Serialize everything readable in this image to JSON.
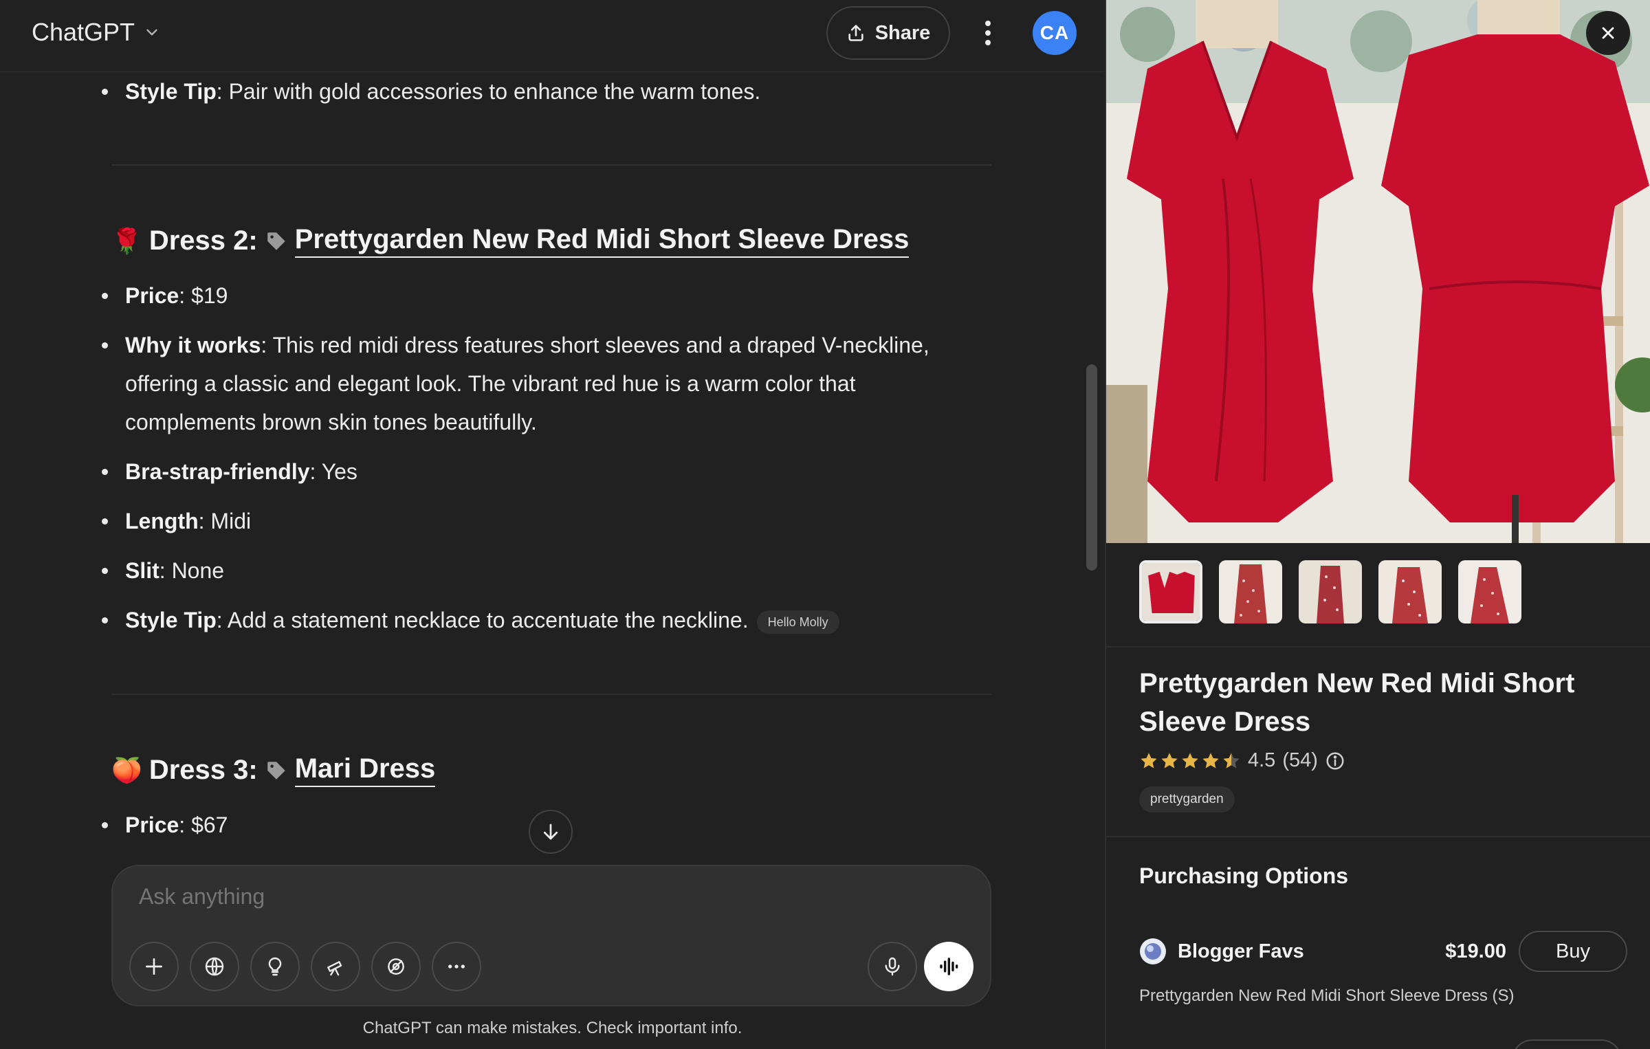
{
  "header": {
    "model_name": "ChatGPT",
    "share_label": "Share",
    "avatar_initials": "CA"
  },
  "chat": {
    "prev_style_tip": {
      "label": "Style Tip",
      "text": ": Pair with gold accessories to enhance the warm tones."
    },
    "dress2": {
      "emoji": "🌹",
      "prefix": "Dress 2:",
      "link_text": "Prettygarden New Red Midi Short Sleeve Dress",
      "price": {
        "label": "Price",
        "text": ": $19"
      },
      "why": {
        "label": "Why it works",
        "text": ": This red midi dress features short sleeves and a draped V-neckline, offering a classic and elegant look. The vibrant red hue is a warm color that complements brown skin tones beautifully."
      },
      "bra": {
        "label": "Bra-strap-friendly",
        "text": ": Yes"
      },
      "length": {
        "label": "Length",
        "text": ": Midi"
      },
      "slit": {
        "label": "Slit",
        "text": ": None"
      },
      "style_tip": {
        "label": "Style Tip",
        "text": ": Add a statement necklace to accentuate the neckline."
      },
      "source": "Hello Molly"
    },
    "dress3": {
      "emoji": "🍑",
      "prefix": "Dress 3:",
      "link_text": "Mari Dress",
      "price": {
        "label": "Price",
        "text": ": $67"
      }
    }
  },
  "composer": {
    "placeholder": "Ask anything",
    "tools": [
      "plus-icon",
      "globe-icon",
      "lightbulb-icon",
      "telescope-icon",
      "paint-icon",
      "more-icon"
    ],
    "disclaimer": "ChatGPT can make mistakes. Check important info."
  },
  "product": {
    "title": "Prettygarden New Red Midi Short Sleeve Dress",
    "rating": "4.5",
    "reviews": "(54)",
    "rating_value": 4.5,
    "brand": "prettygarden",
    "thumbnail_count": 5,
    "purchasing_title": "Purchasing Options",
    "seller": {
      "name": "Blogger Favs",
      "price": "$19.00",
      "buy_label": "Buy",
      "description": "Prettygarden New Red Midi Short Sleeve Dress (S)"
    }
  },
  "colors": {
    "background": "#212121",
    "dress_red": "#c8102e",
    "star": "#e8b547",
    "avatar": "#3b82f6"
  }
}
